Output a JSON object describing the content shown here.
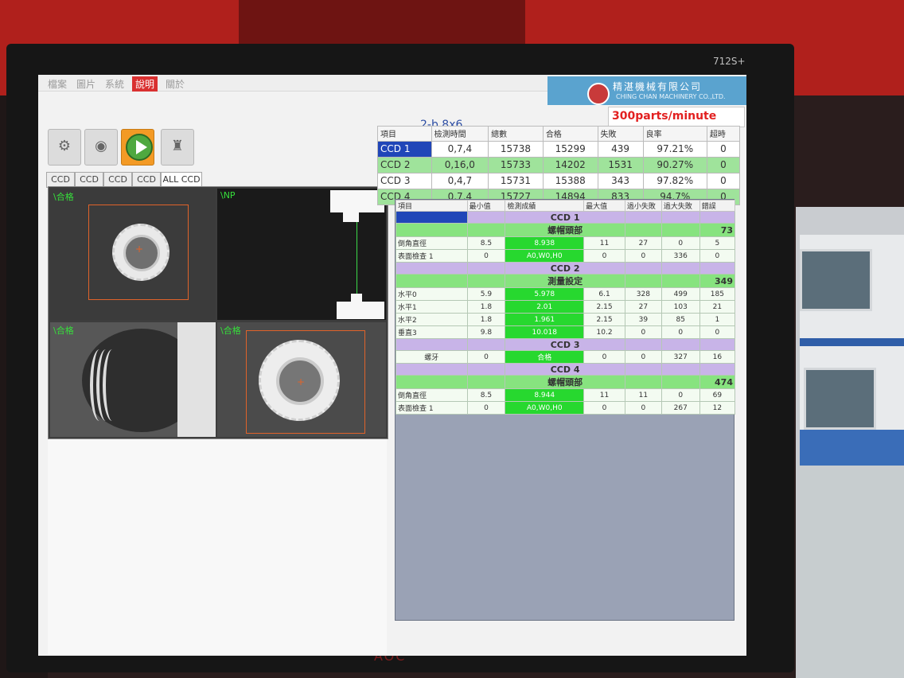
{
  "monitor": {
    "model": "712S+",
    "brand": "AOC"
  },
  "menu": {
    "items": [
      "檔案",
      "圖片",
      "系統",
      "說明",
      "關於"
    ],
    "active_index": 3
  },
  "logo": {
    "cn": "精湛機械有限公司",
    "en": "CHING CHAN MACHINERY CO.,LTD."
  },
  "speed": "300parts/minute",
  "job_title": "2-b  8x6",
  "toolbar": {
    "icons": [
      "ccd-settings-icon",
      "camera-icon",
      "play-icon",
      "calibration-icon"
    ]
  },
  "tabs": [
    "CCD 1",
    "CCD 2",
    "CCD 3",
    "CCD 4",
    "ALL CCD"
  ],
  "cameras": [
    {
      "label": "\\合格"
    },
    {
      "label": "\\NP"
    },
    {
      "label": "\\合格"
    },
    {
      "label": "\\合格"
    }
  ],
  "summary": {
    "headers": [
      "項目",
      "檢測時間",
      "總數",
      "合格",
      "失敗",
      "良率",
      "超時"
    ],
    "rows": [
      [
        "CCD 1",
        "0,7,4",
        "15738",
        "15299",
        "439",
        "97.21%",
        "0"
      ],
      [
        "CCD 2",
        "0,16,0",
        "15733",
        "14202",
        "1531",
        "90.27%",
        "0"
      ],
      [
        "CCD 3",
        "0,4,7",
        "15731",
        "15388",
        "343",
        "97.82%",
        "0"
      ],
      [
        "CCD 4",
        "0,7,4",
        "15727",
        "14894",
        "833",
        "94.7%",
        "0"
      ]
    ]
  },
  "detail": {
    "headers": [
      "項目",
      "最小值",
      "檢測成績",
      "最大值",
      "過小失敗",
      "過大失敗",
      "錯誤"
    ],
    "ccd1": {
      "title": "CCD 1",
      "group": "螺帽頭部",
      "group_count": "73",
      "rows": [
        [
          "倒角直徑",
          "8.5",
          "8.938",
          "11",
          "27",
          "0",
          "5"
        ],
        [
          "表面檢查 1",
          "0",
          "A0,W0,H0",
          "0",
          "0",
          "336",
          "0"
        ]
      ]
    },
    "ccd2": {
      "title": "CCD 2",
      "group": "測量設定",
      "group_count": "349",
      "rows": [
        [
          "水平0",
          "5.9",
          "5.978",
          "6.1",
          "328",
          "499",
          "185"
        ],
        [
          "水平1",
          "1.8",
          "2.01",
          "2.15",
          "27",
          "103",
          "21"
        ],
        [
          "水平2",
          "1.8",
          "1.961",
          "2.15",
          "39",
          "85",
          "1"
        ],
        [
          "垂直3",
          "9.8",
          "10.018",
          "10.2",
          "0",
          "0",
          "0"
        ]
      ]
    },
    "ccd3": {
      "title": "CCD 3",
      "rows": [
        [
          "螺牙",
          "0",
          "合格",
          "0",
          "0",
          "327",
          "16"
        ]
      ]
    },
    "ccd4": {
      "title": "CCD 4",
      "group": "螺帽頭部",
      "group_count": "474",
      "rows": [
        [
          "倒角直徑",
          "8.5",
          "8.944",
          "11",
          "11",
          "0",
          "69"
        ],
        [
          "表面檢查 1",
          "0",
          "A0,W0,H0",
          "0",
          "0",
          "267",
          "12"
        ]
      ]
    }
  },
  "colors": {
    "accent_green": "#27d82f",
    "selected_blue": "#2046b8",
    "alert_red": "#e22020"
  }
}
